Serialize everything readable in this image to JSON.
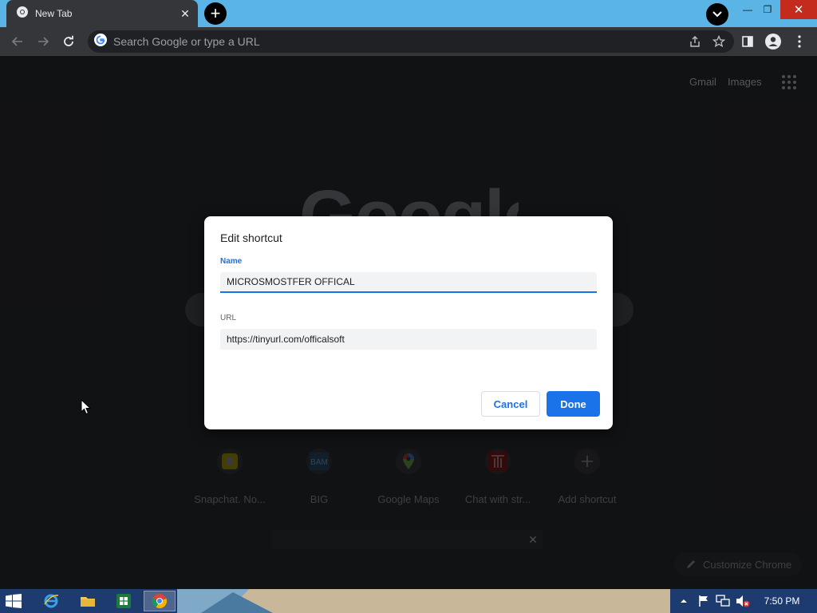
{
  "browser": {
    "tab": {
      "title": "New Tab"
    },
    "omnibox": {
      "placeholder": "Search Google or type a URL"
    }
  },
  "page": {
    "top_links": {
      "gmail": "Gmail",
      "images": "Images"
    },
    "logo": "Google",
    "shortcuts": [
      {
        "label": "Snapchat. No...",
        "icon": "snapchat-icon"
      },
      {
        "label": "BIG",
        "icon": "bam-icon",
        "icon_text": "BAM"
      },
      {
        "label": "Google Maps",
        "icon": "maps-pin-icon"
      },
      {
        "label": "Chat with str...",
        "icon": "t-logo-icon"
      },
      {
        "label": "Add shortcut",
        "icon": "plus-icon"
      }
    ],
    "customize_label": "Customize Chrome"
  },
  "dialog": {
    "title": "Edit shortcut",
    "name_label": "Name",
    "name_value": "MICROSMOSTFER OFFICAL",
    "url_label": "URL",
    "url_value": "https://tinyurl.com/officalsoft",
    "cancel_label": "Cancel",
    "done_label": "Done"
  },
  "taskbar": {
    "apps": [
      "internet-explorer-icon",
      "file-explorer-icon",
      "excel-icon",
      "chrome-icon"
    ],
    "clock": "7:50 PM"
  },
  "colors": {
    "accent": "#1a73e8",
    "titlebar": "#5ab4e6",
    "toolbar": "#35363a",
    "page_bg": "#202124"
  }
}
